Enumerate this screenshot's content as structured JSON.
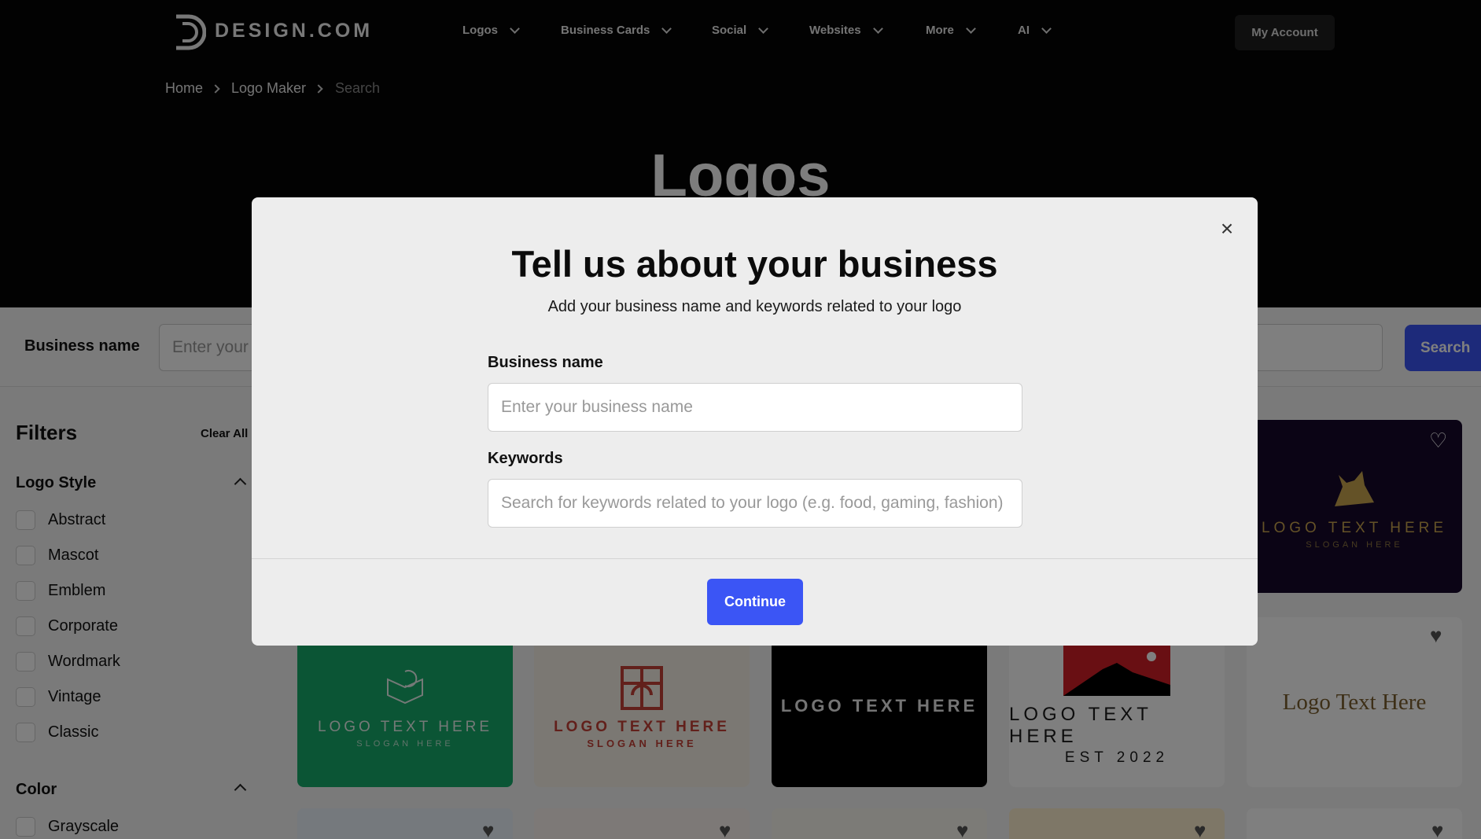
{
  "header": {
    "brand": "DESIGN.COM",
    "nav": [
      {
        "label": "Logos"
      },
      {
        "label": "Business Cards"
      },
      {
        "label": "Social"
      },
      {
        "label": "Websites"
      },
      {
        "label": "More"
      },
      {
        "label": "AI"
      }
    ],
    "account_label": "My Account"
  },
  "breadcrumb": [
    "Home",
    "Logo Maker",
    "Search"
  ],
  "hero": {
    "title": "Logos"
  },
  "searchbar": {
    "label": "Business name",
    "placeholder": "Enter your",
    "button": "Search"
  },
  "filters": {
    "title": "Filters",
    "clear_all": "Clear All",
    "logo_style": {
      "title": "Logo Style",
      "items": [
        "Abstract",
        "Mascot",
        "Emblem",
        "Corporate",
        "Wordmark",
        "Vintage",
        "Classic"
      ]
    },
    "color": {
      "title": "Color",
      "items": [
        "Grayscale"
      ]
    }
  },
  "cards": [
    {
      "text": "LOGO TEXT HERE",
      "slogan": "SLOGAN HERE",
      "bg": "#16082a",
      "fg": "#c9a44e"
    },
    {
      "text": "LOGO TEXT HERE",
      "slogan": "SLOGAN HERE",
      "bg": "#16aa6a",
      "fg": "#e9f3ee"
    },
    {
      "text": "LOGO TEXT HERE",
      "slogan": "SLOGAN HERE",
      "bg": "#f7f1e7",
      "fg": "#c44036"
    },
    {
      "text": "LOGO TEXT HERE",
      "slogan": "",
      "bg": "#000000",
      "fg": "#e8e8e8"
    },
    {
      "text": "LOGO TEXT HERE",
      "slogan": "EST 2022",
      "bg": "#ffffff",
      "fg": "#1a1a1a"
    },
    {
      "text": "Logo Text Here",
      "slogan": "",
      "bg": "#ffffff",
      "fg": "#7b5e2e"
    }
  ],
  "modal": {
    "title": "Tell us about your business",
    "subtitle": "Add your business name and keywords related to your logo",
    "business_label": "Business name",
    "business_placeholder": "Enter your business name",
    "keywords_label": "Keywords",
    "keywords_placeholder": "Search for keywords related to your logo (e.g. food, gaming, fashion)",
    "continue": "Continue",
    "close_icon": "close-icon"
  },
  "colors": {
    "accent": "#3b55f5",
    "hero_bg": "#040404",
    "modal_bg": "#ededed"
  }
}
